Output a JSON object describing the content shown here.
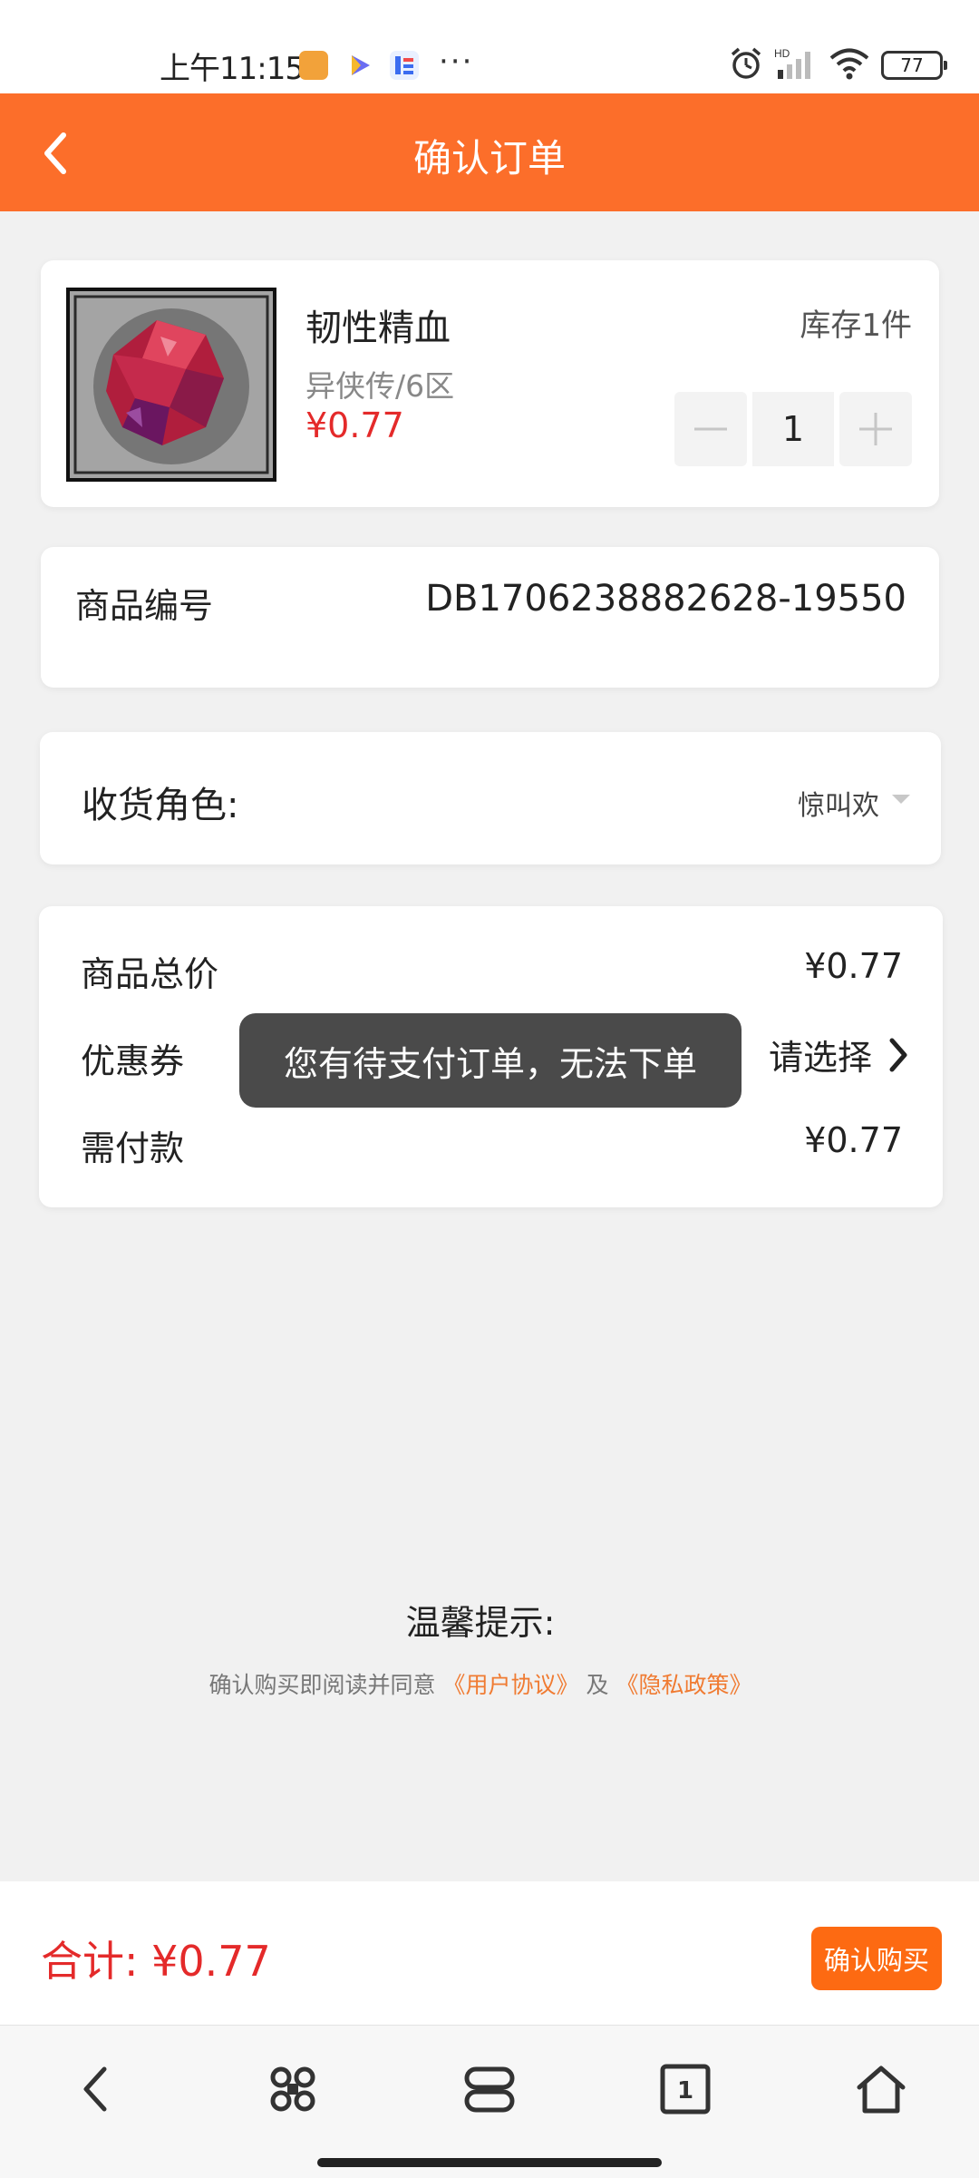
{
  "status_bar": {
    "time": "上午11:15",
    "dots": "···",
    "battery": "77",
    "icons": [
      "app-icon-orange",
      "app-icon-play",
      "app-icon-blue",
      "alarm-icon",
      "signal-icon",
      "wifi-icon",
      "battery-icon"
    ]
  },
  "header": {
    "title": "确认订单",
    "back_icon": "chevron-left-icon"
  },
  "product": {
    "name": "韧性精血",
    "server": "异侠传/6区",
    "price": "¥0.77",
    "stock": "库存1件",
    "quantity": "1",
    "minus": "—",
    "plus": "+"
  },
  "order_code": {
    "label": "商品编号",
    "value": "DB1706238882628-19550"
  },
  "role": {
    "label": "收货角色:",
    "value": "惊叫欢"
  },
  "summary": {
    "total_label": "商品总价",
    "total_value": "¥0.77",
    "coupon_label": "优惠券",
    "coupon_value": "请选择",
    "pay_label": "需付款",
    "pay_value": "¥0.77"
  },
  "toast": {
    "text": "您有待支付订单，无法下单"
  },
  "tips": {
    "title": "温馨提示:",
    "prefix": "确认购买即阅读并同意",
    "agreement": "《用户协议》",
    "and": "及",
    "privacy": "《隐私政策》"
  },
  "bottom": {
    "total": "合计: ¥0.77",
    "buy_label": "确认购买"
  },
  "nav": {
    "items": [
      "back-icon",
      "command-icon",
      "recents-icon",
      "tab-count-icon",
      "home-icon"
    ],
    "tab_count": "1"
  },
  "colors": {
    "accent": "#fc6e2a",
    "price_red": "#e42a2a",
    "link": "#f07b32"
  }
}
